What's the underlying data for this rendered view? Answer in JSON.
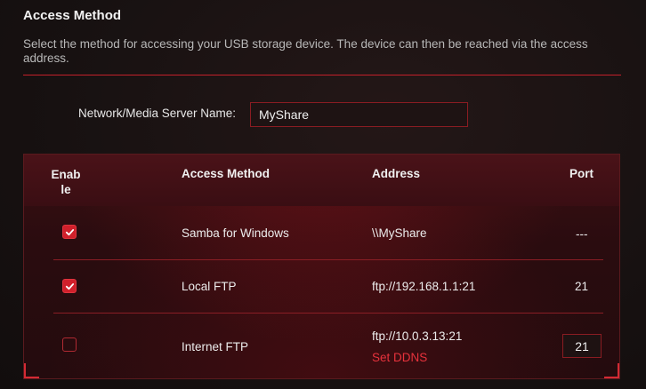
{
  "section": {
    "title": "Access Method",
    "description": "Select the method for accessing your USB storage device. The device can then be reached via the access address."
  },
  "server": {
    "label": "Network/Media Server Name:",
    "value": "MyShare"
  },
  "table": {
    "headers": {
      "enable": "Enable",
      "method": "Access Method",
      "address": "Address",
      "port": "Port"
    },
    "rows": [
      {
        "enabled": true,
        "method": "Samba for Windows",
        "address": "\\\\MyShare",
        "port": "---"
      },
      {
        "enabled": true,
        "method": "Local FTP",
        "address": "ftp://192.168.1.1:21",
        "port": "21"
      },
      {
        "enabled": false,
        "method": "Internet FTP",
        "address": "ftp://10.0.3.13:21",
        "link": "Set DDNS",
        "port_value": "21"
      }
    ]
  },
  "colors": {
    "accent": "#d0202b",
    "link": "#e8323c",
    "background": "#141010"
  },
  "icons": {
    "checkbox_checked": "checkmark-icon"
  }
}
